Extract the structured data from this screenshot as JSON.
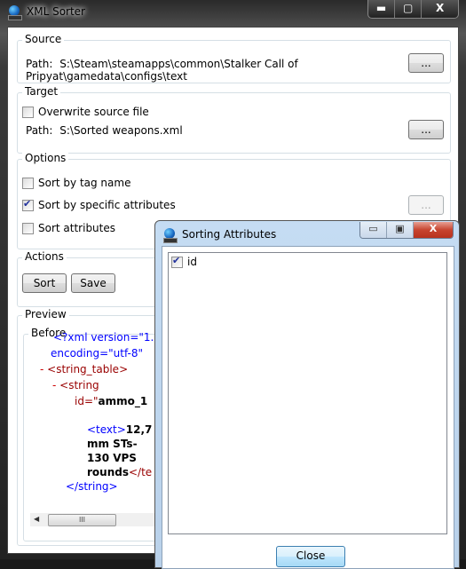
{
  "window": {
    "title": "XML Sorter",
    "icon": "xml-globe-icon",
    "caption_buttons": {
      "minimize": "▬",
      "maximize": "▢",
      "close": "X"
    }
  },
  "source": {
    "label": "Source",
    "path_label": "Path:",
    "path_value": "S:\\Steam\\steamapps\\common\\Stalker Call of Pripyat\\gamedata\\configs\\text",
    "browse_label": "..."
  },
  "target": {
    "label": "Target",
    "overwrite_label": "Overwrite source file",
    "overwrite_checked": false,
    "path_label": "Path:",
    "path_value": "S:\\Sorted weapons.xml",
    "browse_label": "..."
  },
  "options": {
    "label": "Options",
    "items": [
      {
        "label": "Sort by tag name",
        "checked": false
      },
      {
        "label": "Sort by specific attributes",
        "checked": true
      },
      {
        "label": "Sort attributes",
        "checked": false
      }
    ],
    "attr_button_label": "..."
  },
  "actions": {
    "label": "Actions",
    "sort_label": "Sort",
    "save_label": "Save"
  },
  "preview": {
    "label": "Preview",
    "before_label": "Before",
    "lines": {
      "l1": "<?xml version=\"1.",
      "l2": "encoding=\"utf-8\"",
      "l3_minus": "-",
      "l3": "<string_table>",
      "l4_minus": "-",
      "l4": "<string",
      "l5_attr": "id=\"",
      "l5_val": "ammo_1",
      "l6_tag": "<text>",
      "l6_val": "12,7",
      "l7": "mm STs-",
      "l8": "130 VPS",
      "l9_val": "rounds",
      "l9_tag": "</te",
      "l10": "</string>"
    },
    "scroll_thumb_glyph": "III",
    "scroll_left_glyph": "◀"
  },
  "dialog": {
    "title": "Sorting Attributes",
    "caption_buttons": {
      "minimize": "▭",
      "maximize": "▣",
      "close": "X"
    },
    "attributes": [
      {
        "label": "id",
        "checked": true
      }
    ],
    "close_label": "Close"
  }
}
